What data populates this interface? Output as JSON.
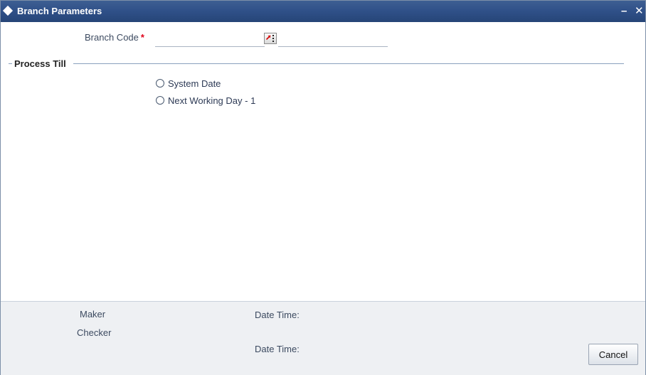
{
  "window": {
    "title": "Branch Parameters",
    "minimize_label": "–",
    "close_label": "✕"
  },
  "form": {
    "branch_code_label": "Branch Code",
    "required_marker": "*",
    "branch_code_value": ""
  },
  "process_till": {
    "section_label": "Process Till",
    "options": [
      {
        "label": "System Date",
        "selected": false
      },
      {
        "label": "Next Working Day - 1",
        "selected": false
      }
    ]
  },
  "footer": {
    "maker_label": "Maker",
    "checker_label": "Checker",
    "maker_datetime_label": "Date Time:",
    "checker_datetime_label": "Date Time:",
    "cancel_label": "Cancel"
  },
  "icons": {
    "title": "diamond-icon",
    "lov": "list-of-values-icon"
  },
  "colors": {
    "titlebar": "#2f5088",
    "required": "#e0001a",
    "section_line": "#8aa0bd",
    "footer_bg": "#eef0f3"
  }
}
